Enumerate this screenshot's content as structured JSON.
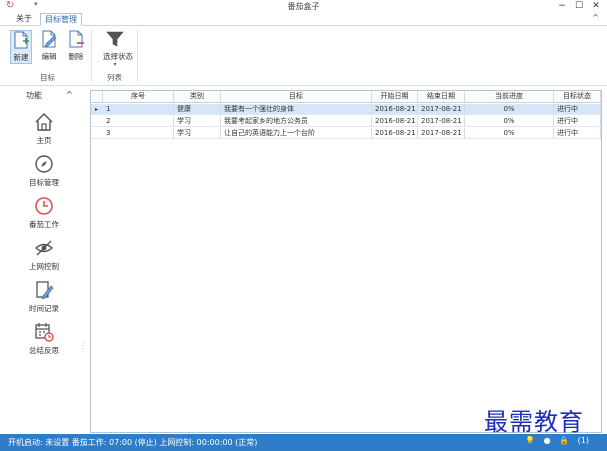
{
  "window": {
    "title": "番茄盒子",
    "app_icon": "refresh-icon",
    "quick_access_arrow": "▾",
    "minimize": "−",
    "maximize": "☐",
    "close": "✕"
  },
  "ribbon": {
    "tabs": [
      {
        "label": "关于",
        "active": false
      },
      {
        "label": "目标管理",
        "active": true
      }
    ],
    "collapse_glyph": "^",
    "groups": [
      {
        "label": "目标",
        "buttons": [
          {
            "label": "新建",
            "icon": "new-document-icon",
            "selected": true
          },
          {
            "label": "编辑",
            "icon": "edit-document-icon",
            "selected": false
          },
          {
            "label": "删除",
            "icon": "delete-document-icon",
            "selected": false
          }
        ]
      },
      {
        "label": "列表",
        "buttons": [
          {
            "label": "选择状态",
            "icon": "filter-icon",
            "dropdown": "▾",
            "selected": false
          }
        ]
      }
    ]
  },
  "nav": {
    "header": "功能",
    "collapse_glyph": "^",
    "items": [
      {
        "label": "主页",
        "icon": "home-icon"
      },
      {
        "label": "目标管理",
        "icon": "compass-icon"
      },
      {
        "label": "番茄工作",
        "icon": "clock-icon"
      },
      {
        "label": "上网控制",
        "icon": "eye-off-icon"
      },
      {
        "label": "时间记录",
        "icon": "pencil-edit-icon"
      },
      {
        "label": "总结反思",
        "icon": "calendar-clock-icon"
      }
    ]
  },
  "grid": {
    "columns": [
      "序号",
      "类别",
      "目标",
      "开始日期",
      "结束日期",
      "当前进度",
      "目标状态"
    ],
    "rows": [
      {
        "no": "1",
        "category": "健康",
        "goal": "我要有一个强壮的身体",
        "start": "2016-08-21",
        "end": "2017-08-21",
        "progress": "0%",
        "status": "进行中",
        "selected": true
      },
      {
        "no": "2",
        "category": "学习",
        "goal": "我要考起家乡的地方公务员",
        "start": "2016-08-21",
        "end": "2017-08-21",
        "progress": "0%",
        "status": "进行中",
        "selected": false
      },
      {
        "no": "3",
        "category": "学习",
        "goal": "让自己的英语能力上一个台阶",
        "start": "2016-08-21",
        "end": "2017-08-21",
        "progress": "0%",
        "status": "进行中",
        "selected": false
      }
    ]
  },
  "status_bar": {
    "text": "开机启动: 未设置  番茄工作: 07:00 (停止)  上网控制: 00:00:00 (正常)",
    "icons": [
      "bulb-icon",
      "tomato-icon",
      "lock-icon"
    ],
    "count": "(1)"
  },
  "watermark": "最需教育",
  "colors": {
    "accent": "#2f7dc8",
    "selection": "#d6e6f7",
    "watermark": "#1f2db8",
    "icon_red": "#d9534f"
  }
}
